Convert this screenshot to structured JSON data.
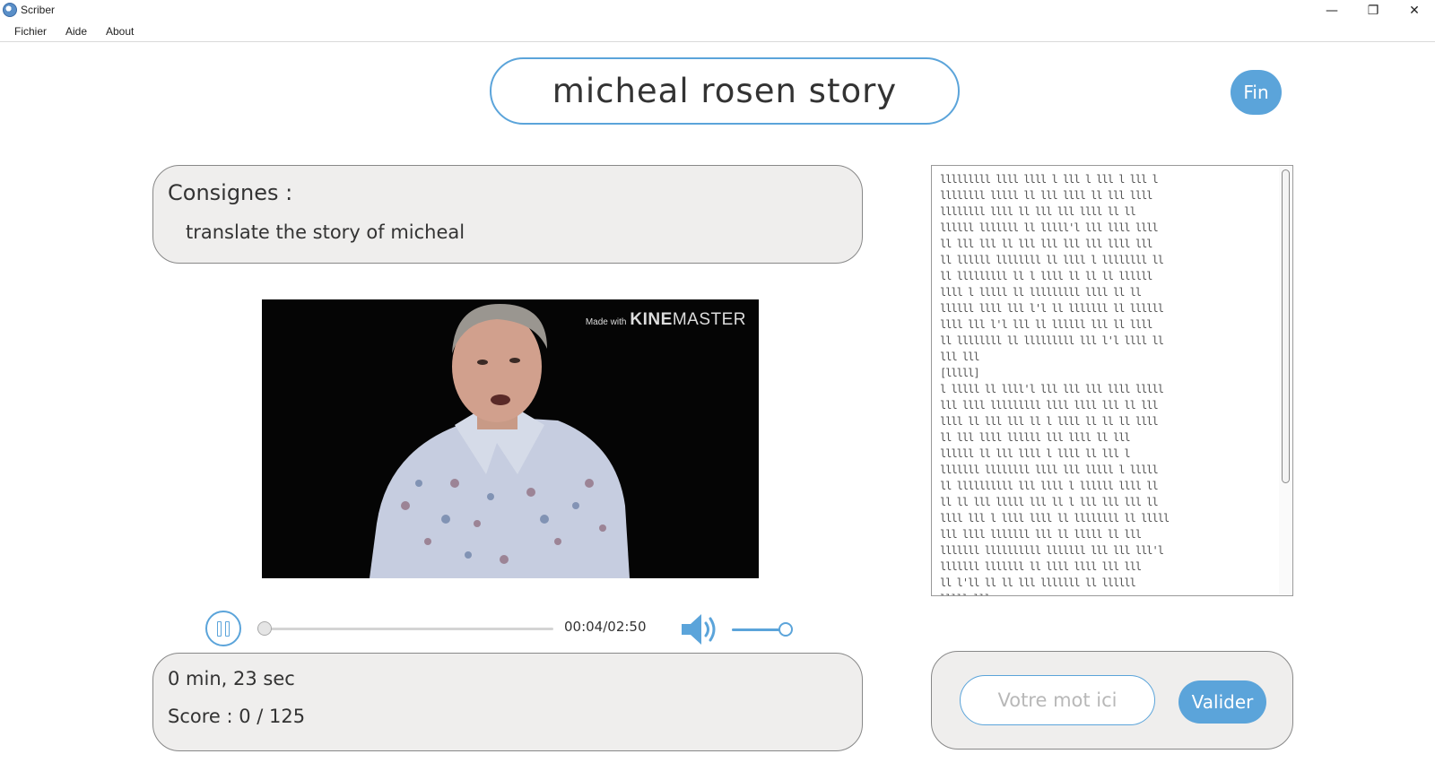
{
  "window": {
    "title": "Scriber",
    "controls": {
      "minimize": "—",
      "maximize": "❐",
      "close": "✕"
    }
  },
  "menu": {
    "items": [
      "Fichier",
      "Aide",
      "About"
    ]
  },
  "header": {
    "title": "micheal rosen story",
    "end_button": "Fin"
  },
  "instructions": {
    "heading": "Consignes :",
    "text": "translate the story of micheal"
  },
  "video": {
    "watermark_small": "Made with",
    "watermark_brand_bold": "KINE",
    "watermark_brand_rest": "MASTER"
  },
  "player": {
    "state": "playing",
    "time": "00:04/02:50",
    "progress": 0.0235,
    "volume": 1.0,
    "volume_icon": "speaker-icon",
    "pause_icon": "pause-icon"
  },
  "stats": {
    "elapsed": "0 min, 23 sec",
    "score": "Score : 0 / 125"
  },
  "transcript": {
    "lines": [
      "lllllllll llll llll l lll l lll l lll l",
      "llllllll lllll ll lll llll ll lll llll",
      "llllllll llll ll lll lll llll ll ll",
      "llllll lllllll ll lllll'l lll llll llll",
      "ll lll lll ll lll lll lll lll llll lll",
      "ll llllll llllllll ll llll l llllllll ll",
      "ll lllllllll ll l llll ll ll ll llllll",
      "llll l lllll ll lllllllll llll ll ll",
      "llllll llll lll l'l ll lllllll ll llllll",
      "llll lll l'l lll ll llllll lll ll llll",
      "ll llllllll ll lllllllll lll l'l llll ll",
      "lll lll",
      "[lllll]",
      "l lllll ll llll'l lll lll lll llll lllll",
      "lll llll lllllllll llll llll lll ll lll",
      "llll ll lll lll ll l llll ll ll ll llll",
      "ll lll llll llllll lll llll ll lll",
      "llllll ll lll llll l llll ll lll l",
      "lllllll llllllll llll lll lllll l lllll",
      "ll llllllllll lll llll l llllll llll ll",
      "ll ll lll lllll lll ll l lll lll lll ll",
      "llll lll l llll llll ll llllllll ll lllll",
      "lll llll lllllll lll ll lllll ll lll",
      "lllllll llllllllll lllllll lll lll lll'l",
      "lllllll lllllll ll llll llll lll lll",
      "ll l'll ll ll lll lllllll ll llllll",
      "lllll lll"
    ]
  },
  "answer": {
    "placeholder": "Votre mot ici",
    "value": "",
    "submit_label": "Valider"
  },
  "colors": {
    "accent": "#5ba4da",
    "panel_bg": "#efeeed",
    "panel_border": "#888888",
    "text": "#333333"
  }
}
